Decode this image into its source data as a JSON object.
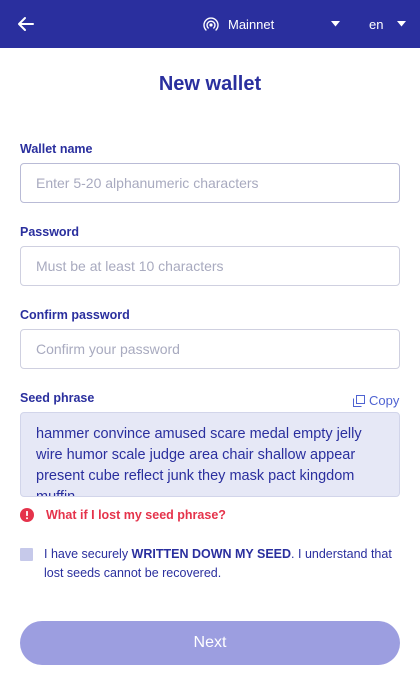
{
  "header": {
    "network_label": "Mainnet",
    "language_label": "en",
    "back_icon": "arrow-left-icon",
    "network_icon": "broadcast-icon",
    "caret_icon": "caret-down-icon"
  },
  "title": "New wallet",
  "form": {
    "wallet_name": {
      "label": "Wallet name",
      "value": "",
      "placeholder": "Enter 5-20 alphanumeric characters"
    },
    "password": {
      "label": "Password",
      "value": "",
      "placeholder": "Must be at least 10 characters"
    },
    "confirm_password": {
      "label": "Confirm password",
      "value": "",
      "placeholder": "Confirm your password"
    },
    "seed": {
      "label": "Seed phrase",
      "copy_label": "Copy",
      "phrase": "hammer convince amused scare medal empty jelly wire humor scale judge area chair shallow appear present cube reflect junk they mask pact kingdom muffin"
    },
    "warning": "What if I lost my seed phrase?",
    "acknowledge": {
      "before": "I have securely ",
      "strong": "WRITTEN DOWN MY SEED",
      "after": ". I understand that lost seeds cannot be recovered.",
      "checked": false
    },
    "next_label": "Next"
  },
  "colors": {
    "header_bg": "#2a2f9e",
    "text_primary": "#2a2f9e",
    "link": "#4f63d2",
    "warning": "#e5334b",
    "seed_bg": "#e6e8f6",
    "button_disabled": "#9c9ee0"
  }
}
